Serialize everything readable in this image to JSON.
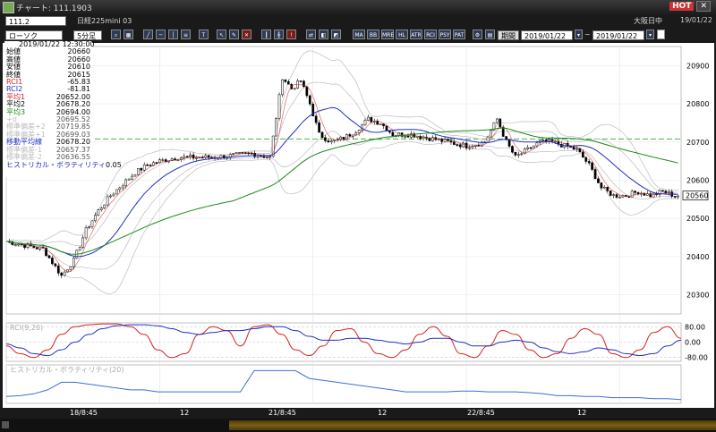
{
  "window": {
    "title": "チャート: 111.1903",
    "hot_label": "HOT",
    "close_label": "✕"
  },
  "header": {
    "code": "111.2",
    "name": "日経225mini 03",
    "session": "大阪日中",
    "date": "19/01/22"
  },
  "controls": {
    "chart_type": "ローソク",
    "period": "5分足",
    "range_label": "期間",
    "from_date": "2019/01/22",
    "to_date": "2019/01/22"
  },
  "toolbar": {
    "labels": [
      "MA",
      "BB",
      "MRE",
      "HL",
      "ATR",
      "RCI",
      "PSY",
      "PAT"
    ]
  },
  "info": {
    "datetime": "2019/01/22 12:30:00",
    "rows": [
      {
        "label": "始値",
        "value": "20660",
        "color": "#000000"
      },
      {
        "label": "高値",
        "value": "20660",
        "color": "#000000"
      },
      {
        "label": "安値",
        "value": "20610",
        "color": "#000000"
      },
      {
        "label": "終値",
        "value": "20615",
        "color": "#000000"
      },
      {
        "label": "RCI1",
        "value": "-65.83",
        "color": "#d42020"
      },
      {
        "label": "RCI2",
        "value": "-81.81",
        "color": "#2030c0"
      },
      {
        "label": "平均1",
        "value": "20652.00",
        "color": "#d42020"
      },
      {
        "label": "平均2",
        "value": "20678.20",
        "color": "#000000"
      },
      {
        "label": "平均3",
        "value": "20694.00",
        "color": "#1a8a1a"
      },
      {
        "label": "+σ",
        "value": "20695.52",
        "color": "#bbbbbb"
      },
      {
        "label": "標準偏差+2",
        "value": "20719.85",
        "color": "#bbbbbb"
      },
      {
        "label": "標準偏差+1",
        "value": "20699.03",
        "color": "#bbbbbb"
      },
      {
        "label": "移動平均線",
        "value": "20678.20",
        "color": "#2030c0"
      },
      {
        "label": "標準偏差-1",
        "value": "20657.37",
        "color": "#bbbbbb"
      },
      {
        "label": "標準偏差-2",
        "value": "20636.55",
        "color": "#bbbbbb"
      },
      {
        "label": "ヒストリカル・ボラティリティ",
        "value": "0.05",
        "color": "#2030c0"
      }
    ]
  },
  "price_axis": {
    "ticks": [
      "20900",
      "20800",
      "20700",
      "20600",
      "20500",
      "20400",
      "20300"
    ],
    "last_price": "20560"
  },
  "rci_panel": {
    "label": "RCI(9,26)",
    "ticks": [
      "80.00",
      "0.00",
      "-80.00"
    ]
  },
  "hv_panel": {
    "label": "ヒストリカル・ボラティリティ(20)"
  },
  "time_axis": [
    "18/8:45",
    "12",
    "21/8:45",
    "12",
    "22/8:45",
    "12"
  ],
  "chart_data": {
    "type": "candlestick",
    "x_labels": [
      "18/8:45",
      "12",
      "21/8:45",
      "12",
      "22/8:45",
      "12"
    ],
    "ylim": [
      20250,
      20950
    ],
    "close_path": [
      [
        0,
        20440
      ],
      [
        6,
        20430
      ],
      [
        12,
        20420
      ],
      [
        18,
        20350
      ],
      [
        22,
        20390
      ],
      [
        26,
        20470
      ],
      [
        30,
        20520
      ],
      [
        34,
        20560
      ],
      [
        38,
        20590
      ],
      [
        42,
        20620
      ],
      [
        46,
        20640
      ],
      [
        50,
        20650
      ],
      [
        56,
        20660
      ],
      [
        62,
        20660
      ],
      [
        68,
        20660
      ],
      [
        74,
        20665
      ],
      [
        80,
        20670
      ],
      [
        86,
        20660
      ],
      [
        90,
        20870
      ],
      [
        93,
        20840
      ],
      [
        96,
        20860
      ],
      [
        99,
        20800
      ],
      [
        102,
        20720
      ],
      [
        106,
        20700
      ],
      [
        110,
        20710
      ],
      [
        114,
        20730
      ],
      [
        118,
        20760
      ],
      [
        122,
        20750
      ],
      [
        126,
        20720
      ],
      [
        132,
        20720
      ],
      [
        138,
        20710
      ],
      [
        144,
        20700
      ],
      [
        150,
        20690
      ],
      [
        156,
        20700
      ],
      [
        160,
        20760
      ],
      [
        163,
        20700
      ],
      [
        166,
        20660
      ],
      [
        170,
        20680
      ],
      [
        174,
        20700
      ],
      [
        178,
        20700
      ],
      [
        182,
        20690
      ],
      [
        186,
        20680
      ],
      [
        190,
        20640
      ],
      [
        194,
        20580
      ],
      [
        198,
        20560
      ],
      [
        202,
        20560
      ],
      [
        206,
        20570
      ],
      [
        210,
        20560
      ],
      [
        214,
        20570
      ],
      [
        218,
        20560
      ]
    ],
    "ma_series": [
      {
        "name": "平均1",
        "color": "#d42020"
      },
      {
        "name": "平均2",
        "color": "#000000"
      },
      {
        "name": "平均3",
        "color": "#1a8a1a"
      },
      {
        "name": "移動平均線",
        "color": "#2030c0"
      }
    ],
    "hline": 20708,
    "rci": {
      "ylim": [
        -100,
        100
      ],
      "rci1": [
        -20,
        -60,
        -80,
        -40,
        40,
        80,
        90,
        95,
        95,
        80,
        40,
        -40,
        -80,
        -60,
        40,
        80,
        60,
        -20,
        80,
        90,
        40,
        -40,
        -70,
        -20,
        60,
        70,
        0,
        -60,
        -80,
        -40,
        40,
        80,
        30,
        -60,
        -80,
        -20,
        60,
        40,
        -40,
        -80,
        -60,
        20,
        70,
        40,
        -60,
        -80,
        -40,
        50,
        80,
        20
      ],
      "rci2": [
        -10,
        -30,
        -60,
        -70,
        -40,
        0,
        40,
        70,
        85,
        90,
        90,
        85,
        70,
        50,
        40,
        50,
        60,
        60,
        70,
        80,
        80,
        60,
        30,
        10,
        10,
        20,
        20,
        10,
        0,
        -10,
        0,
        20,
        20,
        0,
        -20,
        -20,
        0,
        10,
        0,
        -30,
        -50,
        -60,
        -50,
        -30,
        -40,
        -60,
        -70,
        -60,
        -20,
        10
      ]
    },
    "hv": {
      "ylim": [
        0,
        1
      ],
      "values": [
        0.18,
        0.2,
        0.25,
        0.35,
        0.55,
        0.55,
        0.5,
        0.45,
        0.4,
        0.35,
        0.35,
        0.3,
        0.3,
        0.3,
        0.3,
        0.3,
        0.3,
        0.3,
        0.85,
        0.85,
        0.85,
        0.85,
        0.65,
        0.6,
        0.55,
        0.5,
        0.45,
        0.4,
        0.35,
        0.3,
        0.3,
        0.3,
        0.3,
        0.32,
        0.32,
        0.3,
        0.3,
        0.3,
        0.28,
        0.25,
        0.2,
        0.2,
        0.18,
        0.18,
        0.15,
        0.15,
        0.15,
        0.12,
        0.12,
        0.1
      ]
    }
  }
}
